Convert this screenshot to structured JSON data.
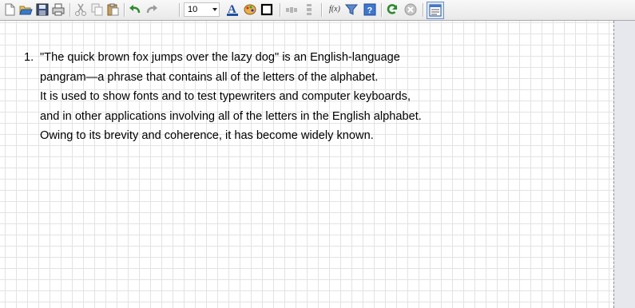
{
  "toolbar": {
    "font_size": "10",
    "function_label": "f(x)",
    "icons": [
      "new-document-icon",
      "open-folder-icon",
      "save-icon",
      "print-icon",
      "cut-icon",
      "copy-icon",
      "paste-icon",
      "undo-icon",
      "redo-icon",
      "font-size-dropdown",
      "font-color-icon",
      "palette-icon",
      "border-icon",
      "align-icon",
      "distribute-icon",
      "function-icon",
      "filter-icon",
      "help-icon",
      "refresh-icon",
      "stop-icon",
      "view-icon"
    ]
  },
  "document": {
    "list_number": "1.",
    "lines": [
      "\"The quick brown fox jumps over the lazy dog\" is an English-language",
      "pangram—a phrase that contains all of the letters of the alphabet.",
      "It is used to show fonts and to test typewriters and computer keyboards,",
      "and in other applications involving all of the letters in the English alphabet.",
      "Owing to its brevity and coherence, it has become widely known."
    ]
  },
  "colors": {
    "grid": "#e3e3e3",
    "panel": "#e6e8ee",
    "toolbar": "#eeeeee"
  }
}
